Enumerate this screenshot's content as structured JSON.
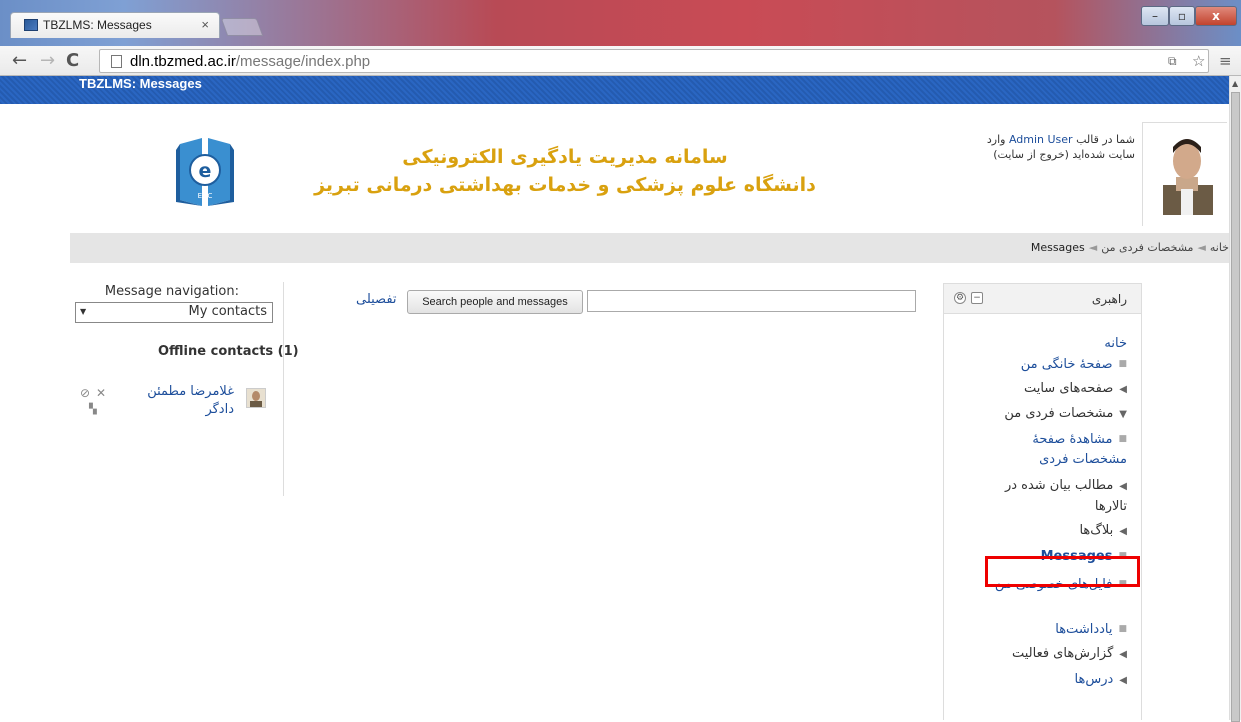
{
  "browser": {
    "tab_title": "TBZLMS: Messages",
    "tab_close": "×",
    "url_domain": "dln.tbzmed.ac.ir",
    "url_path": "/message/index.php",
    "win_min": "–",
    "win_max": "▫",
    "win_close": "x"
  },
  "header": {
    "bluebar_title": "TBZLMS: Messages",
    "site_title_line1": "سامانه مدیریت یادگیری الکترونیکی",
    "site_title_line2": "دانشگاه علوم پزشکی و خدمات بهداشتی درمانی تبریز",
    "logo_label": "EDC",
    "login_prefix": "شما در قالب",
    "login_user": "Admin User",
    "login_suffix": "وارد سایت شده‌اید (خروج از سایت)"
  },
  "breadcrumb": {
    "home": "خانه",
    "profile": "مشخصات فردی من",
    "current": "Messages",
    "separator": "◄"
  },
  "navigation_block": {
    "title": "راهبری",
    "items": [
      {
        "label": "خانه",
        "type": "link"
      },
      {
        "label": "صفحهٔ خانگی من",
        "type": "bullet"
      },
      {
        "label": "صفحه‌های سایت",
        "type": "collapsed"
      },
      {
        "label": "مشخصات فردی من",
        "type": "expanded"
      },
      {
        "label": "مشاهدهٔ صفحهٔ مشخصات فردی",
        "type": "bullet"
      },
      {
        "label": "مطالب بیان شده در تالارها",
        "type": "collapsed"
      },
      {
        "label": "بلاگ‌ها",
        "type": "collapsed"
      },
      {
        "label": "Messages",
        "type": "current"
      },
      {
        "label": "فایل‌های خصوصی من",
        "type": "bullet"
      },
      {
        "label": "یادداشت‌ها",
        "type": "bullet"
      },
      {
        "label": "گزارش‌های فعالیت",
        "type": "collapsed"
      },
      {
        "label": "درس‌ها",
        "type": "collapsed"
      }
    ]
  },
  "search": {
    "input_value": "",
    "button_label": "Search people and messages",
    "advanced_link": "تفصیلی"
  },
  "message_navigation": {
    "label": "Message navigation:",
    "selected": "My contacts",
    "offline_heading": "Offline contacts (1)",
    "contacts": [
      {
        "name": "غلامرضا مطمئن دادگر"
      }
    ]
  },
  "colors": {
    "link": "#1d4e9b",
    "title_gold": "#d9a10f",
    "bar_blue": "#2a66c2",
    "highlight": "#e00000"
  }
}
